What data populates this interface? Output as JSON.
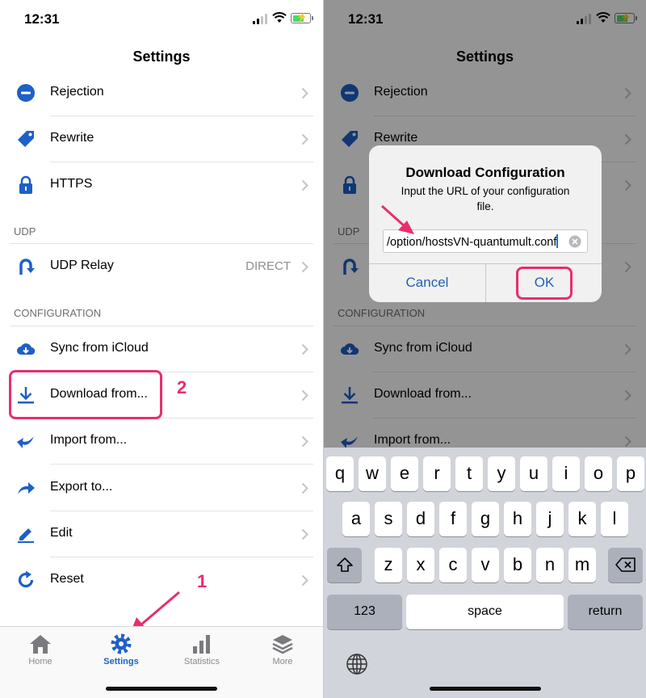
{
  "left": {
    "status": {
      "time": "12:31"
    },
    "nav_title": "Settings",
    "rows": [
      {
        "label": "Rejection",
        "icon": "minus-circle-icon"
      },
      {
        "label": "Rewrite",
        "icon": "tag-icon"
      },
      {
        "label": "HTTPS",
        "icon": "lock-icon"
      }
    ],
    "udp_header": "UDP",
    "udp_relay": {
      "label": "UDP Relay",
      "value": "DIRECT"
    },
    "config_header": "CONFIGURATION",
    "config_rows": [
      {
        "label": "Sync from iCloud"
      },
      {
        "label": "Download from..."
      },
      {
        "label": "Import from..."
      },
      {
        "label": "Export to..."
      },
      {
        "label": "Edit"
      },
      {
        "label": "Reset"
      }
    ],
    "annotations": {
      "step1": "1",
      "step2": "2"
    },
    "tabs": [
      {
        "label": "Home"
      },
      {
        "label": "Settings"
      },
      {
        "label": "Statistics"
      },
      {
        "label": "More"
      }
    ]
  },
  "right": {
    "status": {
      "time": "12:31"
    },
    "nav_title": "Settings",
    "rows": [
      {
        "label": "Rejection"
      },
      {
        "label": "Rewrite"
      }
    ],
    "udp_header": "UDP",
    "config_header": "CONFIGURATION",
    "config_rows": [
      {
        "label": "Sync from iCloud"
      },
      {
        "label": "Download from..."
      },
      {
        "label": "Import from..."
      }
    ],
    "dialog": {
      "title": "Download Configuration",
      "message": "Input the URL of your configuration file.",
      "field_value": "/option/hostsVN-quantumult.conf",
      "cancel": "Cancel",
      "ok": "OK"
    },
    "keyboard": {
      "row1": [
        "q",
        "w",
        "e",
        "r",
        "t",
        "y",
        "u",
        "i",
        "o",
        "p"
      ],
      "row2": [
        "a",
        "s",
        "d",
        "f",
        "g",
        "h",
        "j",
        "k",
        "l"
      ],
      "row3": [
        "z",
        "x",
        "c",
        "v",
        "b",
        "n",
        "m"
      ],
      "numbers": "123",
      "space": "space",
      "return": "return"
    }
  },
  "colors": {
    "accent": "#1d60c6",
    "highlight": "#ea2e6b",
    "chevron": "#c4c4c7"
  }
}
